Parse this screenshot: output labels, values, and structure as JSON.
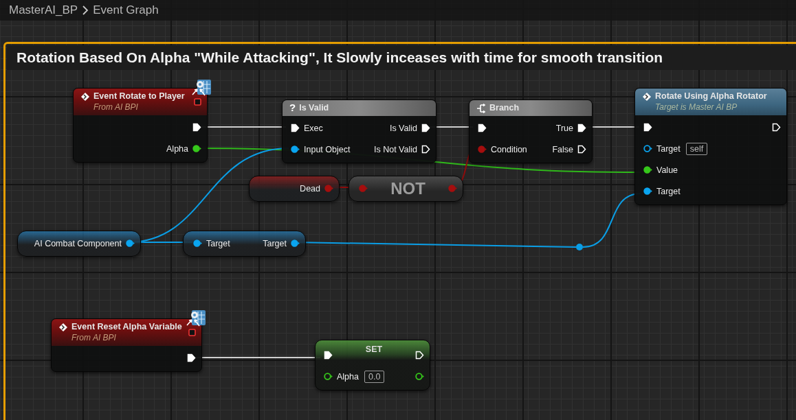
{
  "breadcrumb": {
    "items": [
      "MasterAI_BP",
      "Event Graph"
    ]
  },
  "comment": {
    "title": "Rotation Based On Alpha \"While Attacking\", It Slowly inceases with time for smooth transition"
  },
  "nodes": [
    {
      "kind": "event",
      "title": "Event Rotate to Player",
      "subtitle": "From AI BPI",
      "rows": [
        {
          "out": {
            "kind": "exec",
            "connected": true
          }
        },
        {
          "out": {
            "kind": "float",
            "label": "Alpha",
            "connected": true
          }
        }
      ]
    },
    {
      "kind": "macro",
      "glyph": "?",
      "title": "Is Valid",
      "rows": [
        {
          "in": {
            "kind": "exec",
            "label": "Exec",
            "connected": true
          },
          "out": {
            "kind": "exec",
            "label": "Is Valid",
            "connected": true
          }
        },
        {
          "in": {
            "kind": "object",
            "label": "Input Object",
            "connected": true
          },
          "out": {
            "kind": "exec",
            "label": "Is Not Valid",
            "connected": false
          }
        }
      ]
    },
    {
      "kind": "branch",
      "title": "Branch",
      "rows": [
        {
          "in": {
            "kind": "exec",
            "connected": true
          },
          "out": {
            "kind": "exec",
            "label": "True",
            "connected": true
          }
        },
        {
          "in": {
            "kind": "bool",
            "label": "Condition",
            "connected": true
          },
          "out": {
            "kind": "exec",
            "label": "False",
            "connected": false
          }
        }
      ]
    },
    {
      "kind": "function",
      "title": "Rotate Using Alpha Rotator",
      "subtitle": "Target is Master AI BP",
      "rows": [
        {
          "in": {
            "kind": "exec",
            "connected": true
          },
          "out": {
            "kind": "exec",
            "connected": false
          }
        },
        {
          "in": {
            "kind": "object",
            "label": "Target",
            "value": "self",
            "connected": false
          }
        },
        {
          "in": {
            "kind": "float",
            "label": "Value",
            "connected": true
          }
        },
        {
          "in": {
            "kind": "object",
            "label": "Target",
            "connected": true
          }
        }
      ]
    },
    {
      "kind": "variable",
      "rows": [
        {
          "out": {
            "kind": "bool",
            "label": "Dead",
            "connected": true
          }
        }
      ]
    },
    {
      "kind": "pure",
      "title": "NOT",
      "rows": [
        {
          "in": {
            "kind": "bool",
            "connected": true
          },
          "out": {
            "kind": "bool",
            "connected": true
          }
        }
      ]
    },
    {
      "kind": "variable",
      "rows": [
        {
          "out": {
            "kind": "object",
            "label": "AI Combat Component",
            "connected": true
          }
        }
      ]
    },
    {
      "kind": "variable",
      "rows": [
        {
          "in": {
            "kind": "object",
            "label": "Target",
            "connected": true
          },
          "out": {
            "kind": "object",
            "label": "Target",
            "connected": true
          }
        }
      ]
    },
    {
      "kind": "event",
      "title": "Event Reset Alpha Variable",
      "subtitle": "From AI BPI",
      "rows": [
        {
          "out": {
            "kind": "exec",
            "connected": true
          }
        }
      ]
    },
    {
      "kind": "set",
      "title": "SET",
      "rows": [
        {
          "in": {
            "kind": "exec",
            "connected": true
          },
          "out": {
            "kind": "exec",
            "connected": false
          }
        },
        {
          "in": {
            "kind": "float",
            "label": "Alpha",
            "value": "0.0",
            "connected": false
          },
          "out": {
            "kind": "float",
            "connected": false
          }
        }
      ]
    }
  ]
}
